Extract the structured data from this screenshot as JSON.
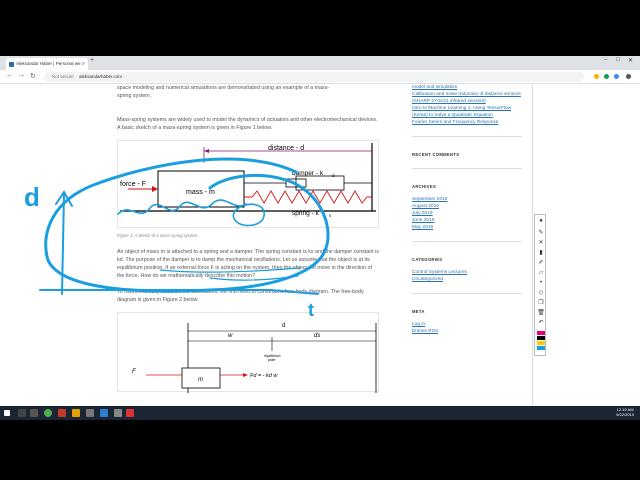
{
  "browser": {
    "tab_title": "Aleksandar Haber | Personal we...",
    "url_security": "Not secure",
    "url": "aleksandarhaber.com",
    "new_tab": "+",
    "minimize": "–",
    "maximize": "□",
    "close": "✕"
  },
  "article": {
    "intro_line1": "space modeling and numerical simulations are demonstrated using an example of a mass-",
    "intro_line2": "spring system.",
    "para2": "Mass-spring systems are widely used to model the dynamics of actuators and other electromechanical devices. A basic sketch of a mass-spring system is given in Figure 1 below.",
    "fig1": {
      "distance_label": "distance - d",
      "force_label": "force - F",
      "mass_label": "mass - m",
      "damper_label": "damper - k",
      "damper_sub": "d",
      "spring_label": "spring - k",
      "spring_sub": "s"
    },
    "fig1_caption": "Figure 1: A sketch of a mass-spring system.",
    "para3": "An object of mass m is attached to a spring and a damper. The spring constant is ks and the damper constant is kd. The purpose of the damper is to damp the mechanical oscillations. Let us assume that the object is at its equilibrium position. If an external force F is acting on the system, then the object will move in the direction of the force. How do we mathematically describe this motion?",
    "para4": "To mathematically describe the oscillations, we first need to construct a free-body diagram. The free-body diagram is given in Figure 2 below.",
    "fig2": {
      "d_label": "d",
      "w_label": "w",
      "ds_label": "ds",
      "eq_label": "equilibrium",
      "eq_label2": "point",
      "F_label": "F",
      "m_label": "m",
      "Fd_label": "Fd = - kd ẇ"
    }
  },
  "sidebar": {
    "top_links": [
      "model and simulation",
      "Calibration and noise reduction of distance sensors (SHARP 2Y0A21 infrared sensors)",
      "Intro to Machine Learning 1: Using TensorFlow (Keras) to Solve a Quadratic Equation",
      "Fourier Series and Frequency Response"
    ],
    "recent_comments_title": "RECENT COMMENTS",
    "archives_title": "ARCHIVES",
    "archives": [
      "September 2019",
      "August 2019",
      "July 2019",
      "June 2019",
      "May 2019"
    ],
    "categories_title": "CATEGORIES",
    "categories": [
      "Control Systems Lectures",
      "Uncategorized"
    ],
    "meta_title": "META",
    "meta": [
      "Log in",
      "Entries RSS"
    ]
  },
  "ink": {
    "letter_d": "d",
    "letter_t": "t",
    "ink_color": "#1a9ee0"
  },
  "taskbar": {
    "time": "12:19 AM",
    "date": "9/22/2019"
  }
}
